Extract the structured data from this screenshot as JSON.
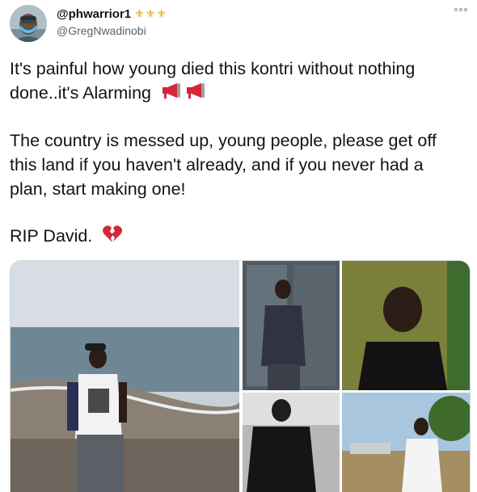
{
  "tweet": {
    "display_name": "@phwarrior1",
    "badges": "⚜⚜⚜",
    "handle": "@GregNwadinobi",
    "more_icon": "more-dots-icon",
    "paragraph1_line1": "It's painful how young died this kontri without nothing",
    "paragraph1_line2": "done..it's Alarming",
    "paragraph2_line1": "The country is messed up, young people, please get off",
    "paragraph2_line2": "this land if you haven't already, and if you never had a",
    "paragraph2_line3": "plan, start making one!",
    "paragraph3": "RIP David.",
    "emoji_loudspeaker": "loudspeaker-icon",
    "emoji_broken_heart": "broken-heart-icon"
  },
  "colors": {
    "text": "#0f1419",
    "secondary": "#536471",
    "accent_red": "#d6263a"
  }
}
